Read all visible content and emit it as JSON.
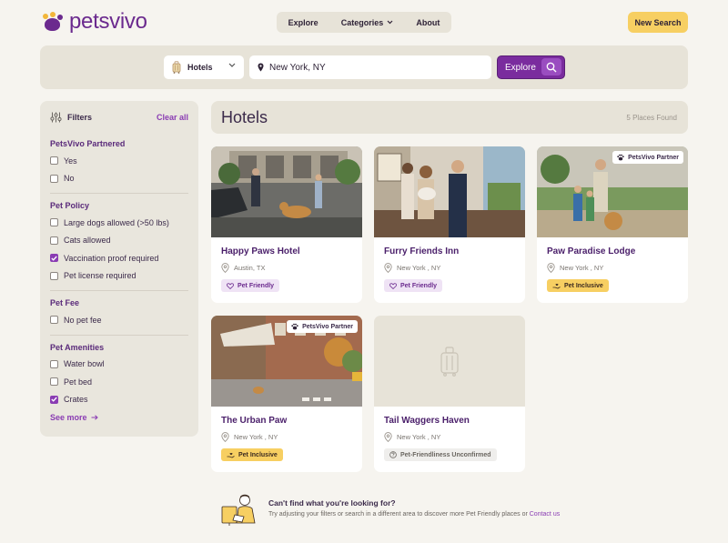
{
  "brand": {
    "name": "petsvivo",
    "color": "#6b2a8e",
    "accent": "#f2b63a"
  },
  "nav": {
    "items": [
      {
        "label": "Explore"
      },
      {
        "label": "Categories"
      },
      {
        "label": "About"
      }
    ]
  },
  "header": {
    "new_search": "New Search"
  },
  "search": {
    "category": "Hotels",
    "location": "New York, NY",
    "explore_label": "Explore",
    "icon": "search-icon"
  },
  "filters": {
    "title": "Filters",
    "clear": "Clear all",
    "groups": [
      {
        "title": "PetsVivo Partnered",
        "options": [
          {
            "label": "Yes",
            "checked": false
          },
          {
            "label": "No",
            "checked": false
          }
        ]
      },
      {
        "title": "Pet Policy",
        "options": [
          {
            "label": "Large dogs allowed (>50 lbs)",
            "checked": false
          },
          {
            "label": "Cats allowed",
            "checked": false
          },
          {
            "label": "Vaccination proof required",
            "checked": true
          },
          {
            "label": "Pet license required",
            "checked": false
          }
        ]
      },
      {
        "title": "Pet Fee",
        "options": [
          {
            "label": "No pet fee",
            "checked": false
          }
        ]
      },
      {
        "title": "Pet Amenities",
        "options": [
          {
            "label": "Water bowl",
            "checked": false
          },
          {
            "label": "Pet bed",
            "checked": false
          },
          {
            "label": "Crates",
            "checked": true
          }
        ]
      }
    ],
    "see_more": "See more"
  },
  "results": {
    "title": "Hotels",
    "count": "5 Places Found",
    "cards": [
      {
        "name": "Happy Paws Hotel",
        "city": "Austin, TX",
        "badge": "Pet Friendly",
        "badge_type": "friendly",
        "partner": ""
      },
      {
        "name": "Furry Friends Inn",
        "city": "New York , NY",
        "badge": "Pet Friendly",
        "badge_type": "friendly",
        "partner": ""
      },
      {
        "name": "Paw Paradise Lodge",
        "city": "New York , NY",
        "badge": "Pet Inclusive",
        "badge_type": "inclusive",
        "partner": "PetsVivo Partner"
      },
      {
        "name": "The Urban Paw",
        "city": "New York , NY",
        "badge": "Pet Inclusive",
        "badge_type": "inclusive",
        "partner": "PetsVivo Partner"
      },
      {
        "name": "Tail Waggers Haven",
        "city": "New York , NY",
        "badge": "Pet-Friendliness Unconfirmed",
        "badge_type": "unconfirmed",
        "partner": ""
      }
    ]
  },
  "cta": {
    "heading": "Can't find what you're looking for?",
    "text": "Try adjusting your filters or search in a different area to discover more Pet Friendly places or ",
    "link": "Contact us"
  }
}
